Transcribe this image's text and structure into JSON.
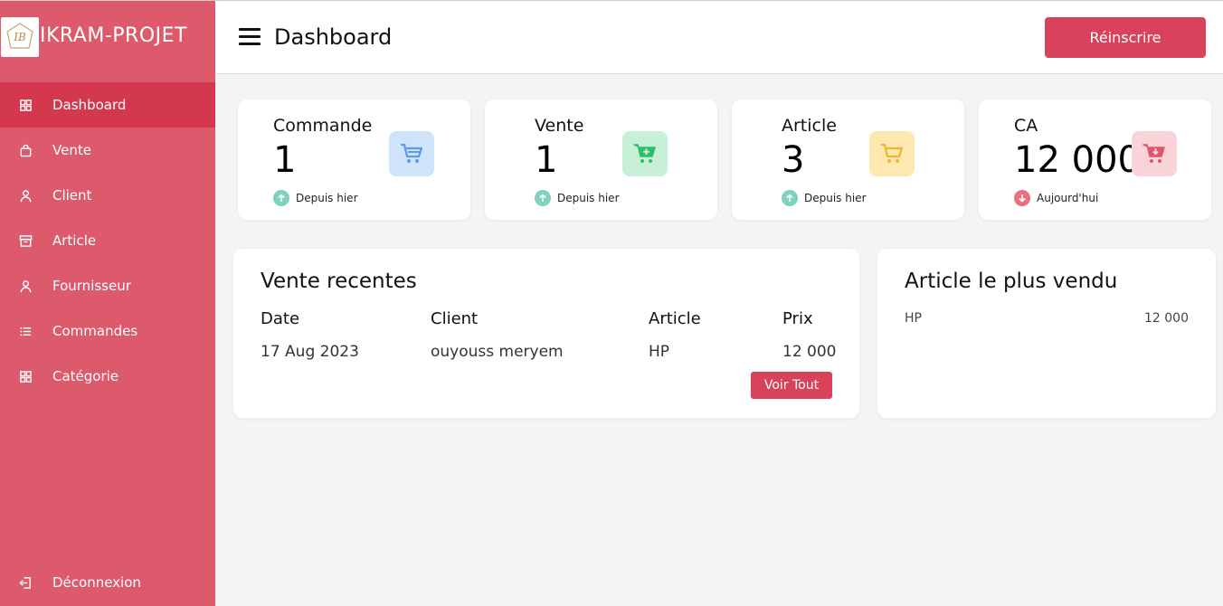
{
  "brand": {
    "title": "IKRAM-PROJET"
  },
  "sidebar": {
    "items": [
      {
        "label": "Dashboard",
        "icon": "grid-icon",
        "active": true
      },
      {
        "label": "Vente",
        "icon": "bag-icon"
      },
      {
        "label": "Client",
        "icon": "user-icon"
      },
      {
        "label": "Article",
        "icon": "archive-icon"
      },
      {
        "label": "Fournisseur",
        "icon": "user-icon"
      },
      {
        "label": "Commandes",
        "icon": "list-icon"
      },
      {
        "label": "Catégorie",
        "icon": "grid-icon"
      }
    ],
    "logout": {
      "label": "Déconnexion",
      "icon": "logout-icon"
    }
  },
  "header": {
    "title": "Dashboard",
    "button_label": "Réinscrire"
  },
  "stats": [
    {
      "label": "Commande",
      "value": "1",
      "trend": "Depuis hier",
      "trend_dir": "up",
      "icon": "cart-icon",
      "icon_bg": "#cfe3fb",
      "icon_color": "#5b9ae8"
    },
    {
      "label": "Vente",
      "value": "1",
      "trend": "Depuis hier",
      "trend_dir": "up",
      "icon": "cart-plus-icon",
      "icon_bg": "#c7f0d6",
      "icon_color": "#2fbf6a"
    },
    {
      "label": "Article",
      "value": "3",
      "trend": "Depuis hier",
      "trend_dir": "up",
      "icon": "cart-icon",
      "icon_bg": "#fde8b0",
      "icon_color": "#f2b42a"
    },
    {
      "label": "CA",
      "value": "12 000",
      "trend": "Aujourd'hui",
      "trend_dir": "down",
      "icon": "cart-down-icon",
      "icon_bg": "#f8d3d8",
      "icon_color": "#e0566a"
    }
  ],
  "recent_sales": {
    "title": "Vente recentes",
    "columns": [
      "Date",
      "Client",
      "Article",
      "Prix"
    ],
    "rows": [
      {
        "date": "17 Aug 2023",
        "client": "ouyouss meryem",
        "article": "HP",
        "prix": "12 000"
      }
    ],
    "button_label": "Voir Tout"
  },
  "best_seller": {
    "title": "Article le plus vendu",
    "rows": [
      {
        "name": "HP",
        "value": "12 000"
      }
    ]
  },
  "colors": {
    "sidebar_bg": "#dc5a6c",
    "sidebar_active": "#d3384f",
    "accent": "#d8425a",
    "trend_up": "#7fd3bd",
    "trend_down": "#e8707f"
  }
}
